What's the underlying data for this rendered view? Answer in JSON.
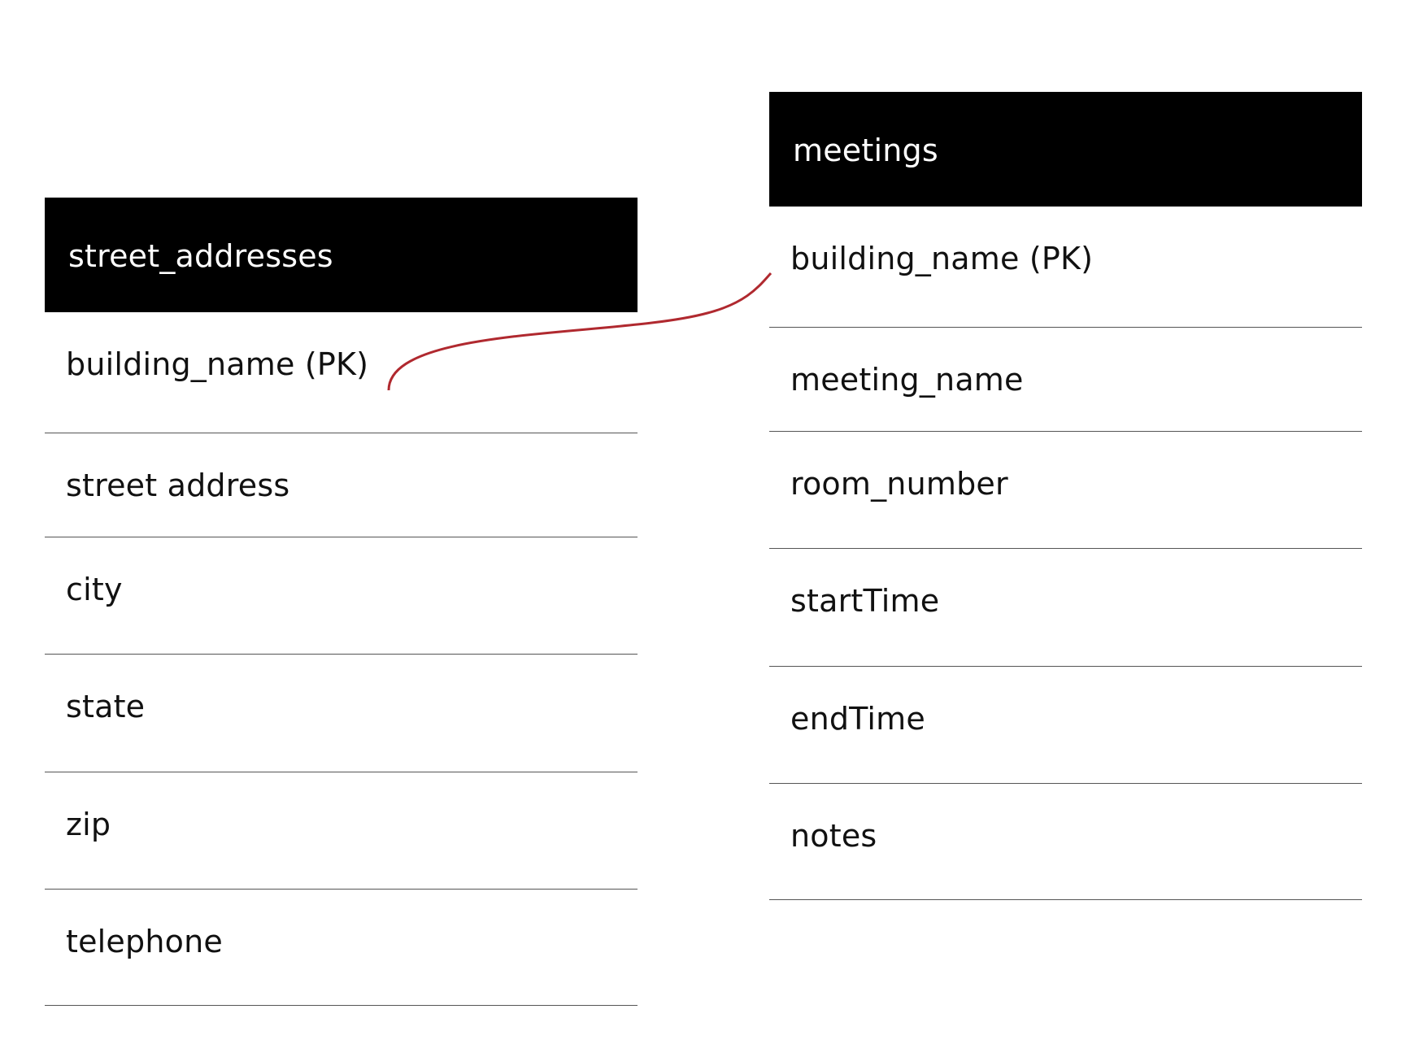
{
  "tables": {
    "left": {
      "title": "street_addresses",
      "fields": [
        "building_name (PK)",
        "street address",
        "city",
        "state",
        "zip",
        "telephone"
      ]
    },
    "right": {
      "title": "meetings",
      "fields": [
        "building_name (PK)",
        "meeting_name",
        "room_number",
        "startTime",
        "endTime",
        "notes"
      ]
    }
  },
  "relationship": {
    "from": "street_addresses.building_name",
    "to": "meetings.building_name",
    "color": "#b0292f"
  },
  "colors": {
    "header_bg": "#000000",
    "header_text": "#ffffff",
    "divider": "#555555"
  }
}
